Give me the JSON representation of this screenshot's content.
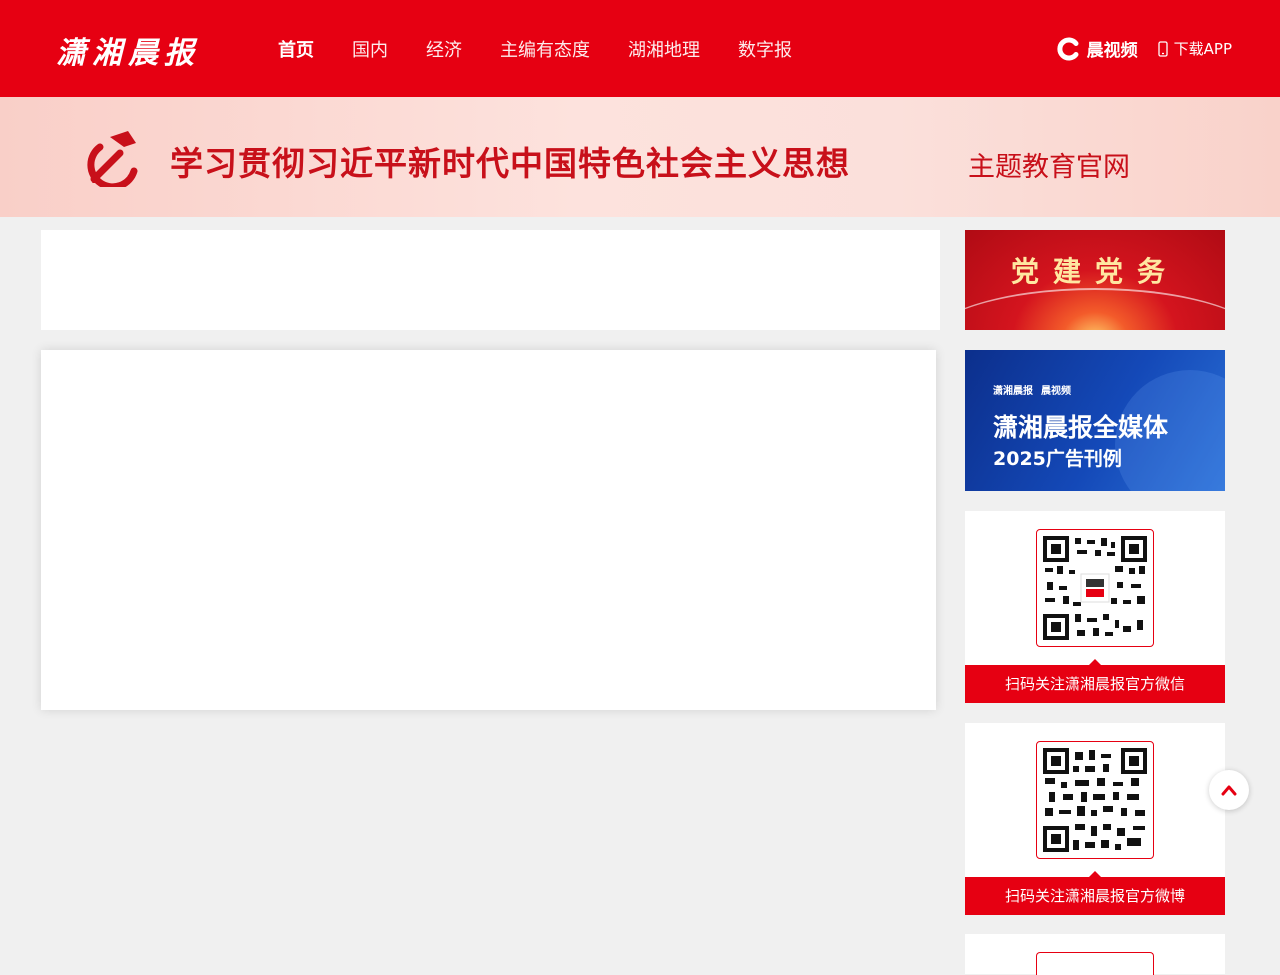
{
  "header": {
    "logo": "潇湘晨报",
    "nav": [
      {
        "label": "首页",
        "active": true
      },
      {
        "label": "国内",
        "active": false
      },
      {
        "label": "经济",
        "active": false
      },
      {
        "label": "主编有态度",
        "active": false
      },
      {
        "label": "湖湘地理",
        "active": false
      },
      {
        "label": "数字报",
        "active": false
      }
    ],
    "video_brand": "晨视频",
    "download_label": "下载APP",
    "colors": {
      "brand_red": "#e60012"
    }
  },
  "banner": {
    "title": "学习贯彻习近平新时代中国特色社会主义思想",
    "subtitle": "主题教育官网",
    "icon": "hammer-sickle-icon"
  },
  "sidebar": {
    "party_card_title": "党建党务",
    "ad": {
      "brand": "潇湘晨报",
      "brand2": "晨视频",
      "line1": "潇湘晨报全媒体",
      "line2": "2025广告刊例"
    },
    "qr_cards": [
      {
        "caption": "扫码关注潇湘晨报官方微信"
      },
      {
        "caption": "扫码关注潇湘晨报官方微博"
      }
    ]
  }
}
